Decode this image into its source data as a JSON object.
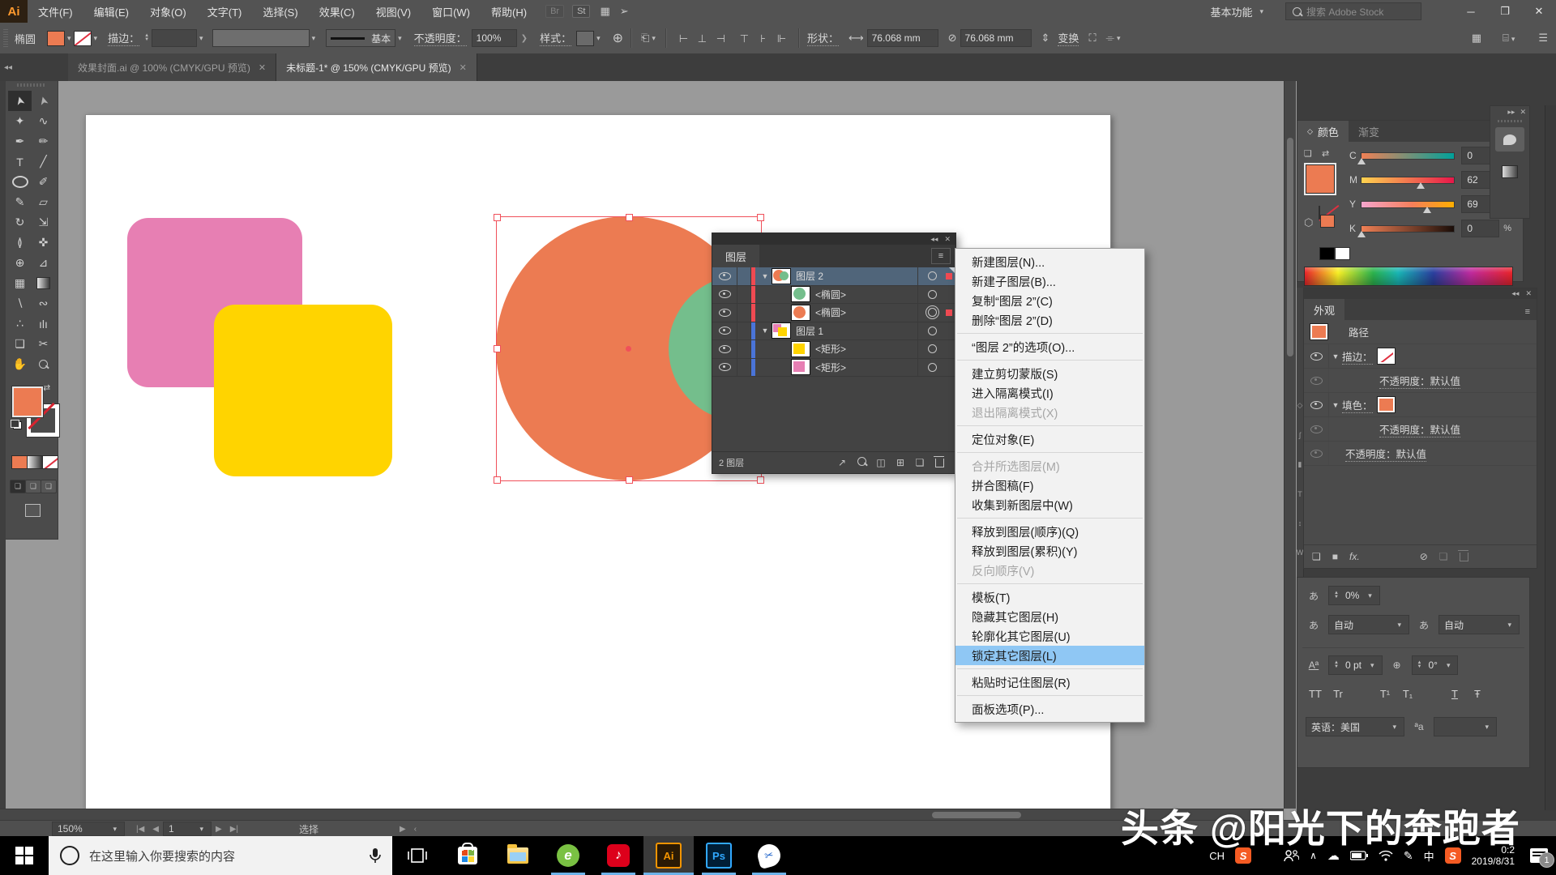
{
  "window": {
    "logo": "Ai",
    "workspace_switcher": "基本功能",
    "stock_search_placeholder": "搜索 Adobe Stock"
  },
  "menubar": {
    "items": [
      {
        "label": "文件(F)"
      },
      {
        "label": "编辑(E)"
      },
      {
        "label": "对象(O)"
      },
      {
        "label": "文字(T)"
      },
      {
        "label": "选择(S)"
      },
      {
        "label": "效果(C)"
      },
      {
        "label": "视图(V)"
      },
      {
        "label": "窗口(W)"
      },
      {
        "label": "帮助(H)"
      }
    ],
    "badges": [
      {
        "label": "Br"
      },
      {
        "label": "St"
      }
    ]
  },
  "controlbar": {
    "tool_name": "椭圆",
    "stroke_label": "描边：",
    "brush_name": "基本",
    "opacity_label": "不透明度：",
    "opacity_value": "100%",
    "style_label": "样式：",
    "shape_label": "形状：",
    "width_value": "76.068 mm",
    "height_value": "76.068 mm",
    "transform_label": "变换"
  },
  "document_tabs": [
    {
      "title": "效果封面.ai @ 100% (CMYK/GPU 预览)"
    },
    {
      "title": "未标题-1* @ 150% (CMYK/GPU 预览)"
    }
  ],
  "colors": {
    "orange": "#ec7b52",
    "green": "#74be8c",
    "pink": "#e77fb3",
    "yellow": "#ffd400",
    "selection_red": "#f0505a",
    "layer_blue": "#4a74d8",
    "menu_highlight": "#8fc7f4",
    "panel_bg": "#535353",
    "canvas_bg": "#9a9a9a"
  },
  "layers_panel": {
    "title": "图层",
    "rows": [
      {
        "label": "图层 2"
      },
      {
        "label": "<椭圆>"
      },
      {
        "label": "<椭圆>"
      },
      {
        "label": "图层 1"
      },
      {
        "label": "<矩形>"
      },
      {
        "label": "<矩形>"
      }
    ],
    "footer_count": "2 图层"
  },
  "context_menu": {
    "items": [
      {
        "label": "新建图层(N)..."
      },
      {
        "label": "新建子图层(B)..."
      },
      {
        "label": "复制“图层 2”(C)"
      },
      {
        "label": "删除“图层 2”(D)"
      },
      {
        "label": "“图层 2”的选项(O)..."
      },
      {
        "label": "建立剪切蒙版(S)"
      },
      {
        "label": "进入隔离模式(I)"
      },
      {
        "label": "退出隔离模式(X)",
        "disabled": true
      },
      {
        "label": "定位对象(E)"
      },
      {
        "label": "合并所选图层(M)",
        "disabled": true
      },
      {
        "label": "拼合图稿(F)"
      },
      {
        "label": "收集到新图层中(W)"
      },
      {
        "label": "释放到图层(顺序)(Q)"
      },
      {
        "label": "释放到图层(累积)(Y)"
      },
      {
        "label": "反向顺序(V)",
        "disabled": true
      },
      {
        "label": "模板(T)"
      },
      {
        "label": "隐藏其它图层(H)"
      },
      {
        "label": "轮廓化其它图层(U)"
      },
      {
        "label": "锁定其它图层(L)",
        "highlighted": true
      },
      {
        "label": "粘贴时记住图层(R)"
      },
      {
        "label": "面板选项(P)..."
      }
    ]
  },
  "color_panel": {
    "tab_color": "颜色",
    "tab_gradient": "渐变",
    "sliders": [
      {
        "channel": "C",
        "value": "0",
        "unit": "%"
      },
      {
        "channel": "M",
        "value": "62",
        "unit": "%"
      },
      {
        "channel": "Y",
        "value": "69",
        "unit": "%"
      },
      {
        "channel": "K",
        "value": "0",
        "unit": "%"
      }
    ]
  },
  "appearance_panel": {
    "title": "外观",
    "object_type": "路径",
    "stroke_label": "描边：",
    "fill_label": "填色：",
    "opacity_rows": [
      "不透明度：默认值",
      "不透明度：默认值",
      "不透明度：默认值"
    ],
    "fx_label": "fx."
  },
  "character_panel": {
    "tsume_value": "0%",
    "aki_left": "自动",
    "aki_right": "自动",
    "baseline_shift": "0 pt",
    "rotation": "0°",
    "buttons": [
      "TT",
      "Tr",
      "T¹",
      "T₁",
      "T",
      "Ŧ"
    ],
    "language": "英语：美国"
  },
  "statusbar": {
    "zoom": "150%",
    "artboard": "1",
    "status": "选择"
  },
  "taskbar": {
    "search_placeholder": "在这里输入你要搜索的内容",
    "apps": [
      {
        "name": "microsoft-store"
      },
      {
        "name": "file-explorer"
      },
      {
        "name": "360-browser",
        "label": "e"
      },
      {
        "name": "netease-music",
        "label": "♪"
      },
      {
        "name": "illustrator",
        "label": "Ai"
      },
      {
        "name": "photoshop",
        "label": "Ps"
      },
      {
        "name": "snip-tool",
        "label": "✂"
      }
    ],
    "tray": {
      "ime_ch": "CH",
      "ime_zh": "中",
      "time": "0:2",
      "date": "2019/8/31",
      "badge": "1"
    }
  },
  "watermark": "头条 @阳光下的奔跑者"
}
